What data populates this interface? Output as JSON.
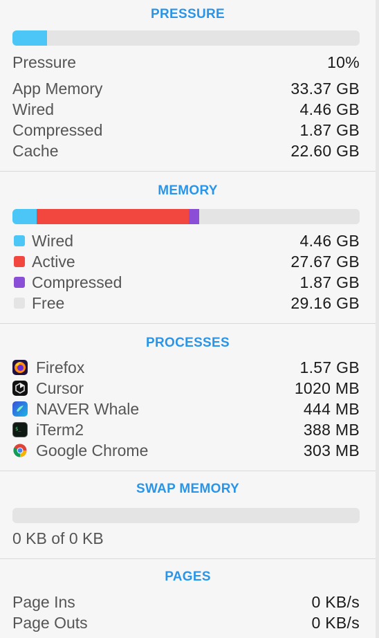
{
  "pressure": {
    "title": "PRESSURE",
    "level_percent": 10,
    "bar_color": "#4cc6f7",
    "label": "Pressure",
    "value": "10%",
    "stats": [
      {
        "label": "App Memory",
        "value": "33.37 GB"
      },
      {
        "label": "Wired",
        "value": "4.46 GB"
      },
      {
        "label": "Compressed",
        "value": "1.87 GB"
      },
      {
        "label": "Cache",
        "value": "22.60 GB"
      }
    ]
  },
  "memory": {
    "title": "MEMORY",
    "items": [
      {
        "label": "Wired",
        "value": "4.46 GB",
        "gb": 4.46,
        "color": "#4cc6f7"
      },
      {
        "label": "Active",
        "value": "27.67 GB",
        "gb": 27.67,
        "color": "#f2473e"
      },
      {
        "label": "Compressed",
        "value": "1.87 GB",
        "gb": 1.87,
        "color": "#8a4fd6"
      },
      {
        "label": "Free",
        "value": "29.16 GB",
        "gb": 29.16,
        "color": "#e4e4e4"
      }
    ]
  },
  "processes": {
    "title": "PROCESSES",
    "items": [
      {
        "name": "Firefox",
        "value": "1.57 GB",
        "icon": "firefox-icon"
      },
      {
        "name": "Cursor",
        "value": "1020 MB",
        "icon": "cursor-icon"
      },
      {
        "name": "NAVER Whale",
        "value": "444 MB",
        "icon": "naver-whale-icon"
      },
      {
        "name": "iTerm2",
        "value": "388 MB",
        "icon": "iterm2-icon"
      },
      {
        "name": "Google Chrome",
        "value": "303 MB",
        "icon": "google-chrome-icon"
      }
    ]
  },
  "swap": {
    "title": "SWAP MEMORY",
    "used_percent": 0,
    "text": "0 KB of 0 KB"
  },
  "pages": {
    "title": "PAGES",
    "items": [
      {
        "label": "Page Ins",
        "value": "0 KB/s"
      },
      {
        "label": "Page Outs",
        "value": "0 KB/s"
      }
    ]
  }
}
